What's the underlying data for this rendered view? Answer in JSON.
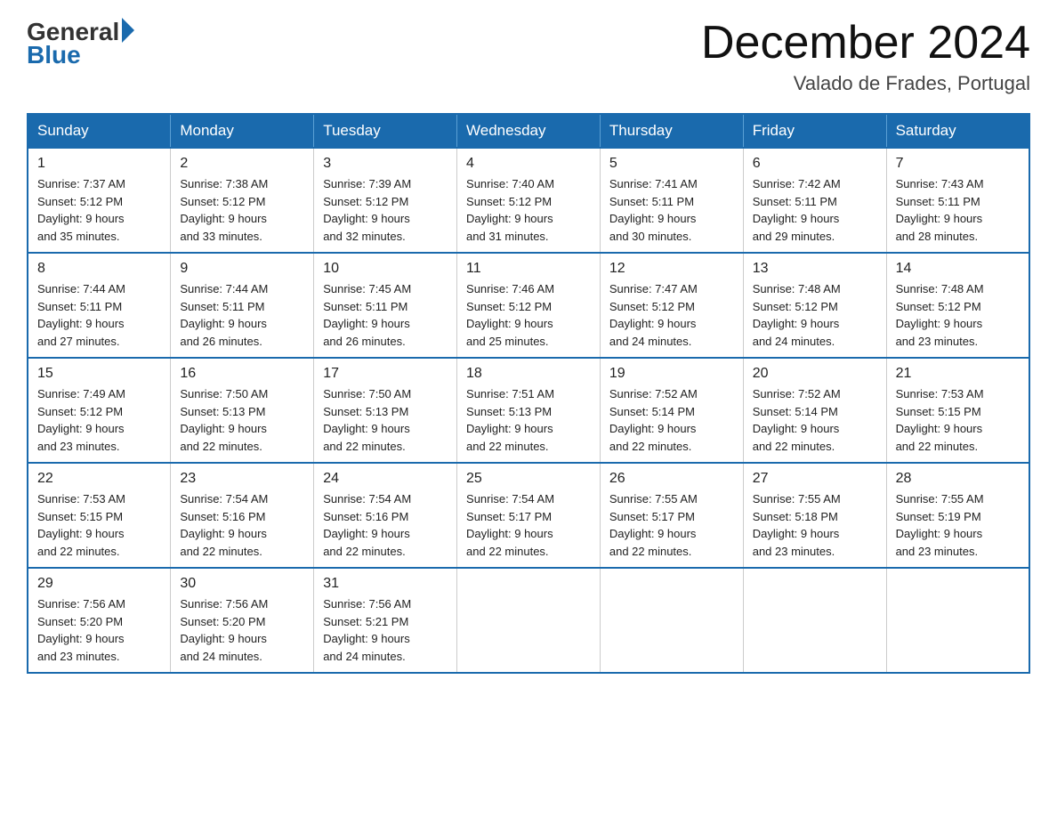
{
  "logo": {
    "general": "General",
    "blue": "Blue"
  },
  "title": "December 2024",
  "location": "Valado de Frades, Portugal",
  "days_of_week": [
    "Sunday",
    "Monday",
    "Tuesday",
    "Wednesday",
    "Thursday",
    "Friday",
    "Saturday"
  ],
  "weeks": [
    [
      {
        "day": "1",
        "sunrise": "7:37 AM",
        "sunset": "5:12 PM",
        "daylight": "9 hours and 35 minutes."
      },
      {
        "day": "2",
        "sunrise": "7:38 AM",
        "sunset": "5:12 PM",
        "daylight": "9 hours and 33 minutes."
      },
      {
        "day": "3",
        "sunrise": "7:39 AM",
        "sunset": "5:12 PM",
        "daylight": "9 hours and 32 minutes."
      },
      {
        "day": "4",
        "sunrise": "7:40 AM",
        "sunset": "5:12 PM",
        "daylight": "9 hours and 31 minutes."
      },
      {
        "day": "5",
        "sunrise": "7:41 AM",
        "sunset": "5:11 PM",
        "daylight": "9 hours and 30 minutes."
      },
      {
        "day": "6",
        "sunrise": "7:42 AM",
        "sunset": "5:11 PM",
        "daylight": "9 hours and 29 minutes."
      },
      {
        "day": "7",
        "sunrise": "7:43 AM",
        "sunset": "5:11 PM",
        "daylight": "9 hours and 28 minutes."
      }
    ],
    [
      {
        "day": "8",
        "sunrise": "7:44 AM",
        "sunset": "5:11 PM",
        "daylight": "9 hours and 27 minutes."
      },
      {
        "day": "9",
        "sunrise": "7:44 AM",
        "sunset": "5:11 PM",
        "daylight": "9 hours and 26 minutes."
      },
      {
        "day": "10",
        "sunrise": "7:45 AM",
        "sunset": "5:11 PM",
        "daylight": "9 hours and 26 minutes."
      },
      {
        "day": "11",
        "sunrise": "7:46 AM",
        "sunset": "5:12 PM",
        "daylight": "9 hours and 25 minutes."
      },
      {
        "day": "12",
        "sunrise": "7:47 AM",
        "sunset": "5:12 PM",
        "daylight": "9 hours and 24 minutes."
      },
      {
        "day": "13",
        "sunrise": "7:48 AM",
        "sunset": "5:12 PM",
        "daylight": "9 hours and 24 minutes."
      },
      {
        "day": "14",
        "sunrise": "7:48 AM",
        "sunset": "5:12 PM",
        "daylight": "9 hours and 23 minutes."
      }
    ],
    [
      {
        "day": "15",
        "sunrise": "7:49 AM",
        "sunset": "5:12 PM",
        "daylight": "9 hours and 23 minutes."
      },
      {
        "day": "16",
        "sunrise": "7:50 AM",
        "sunset": "5:13 PM",
        "daylight": "9 hours and 22 minutes."
      },
      {
        "day": "17",
        "sunrise": "7:50 AM",
        "sunset": "5:13 PM",
        "daylight": "9 hours and 22 minutes."
      },
      {
        "day": "18",
        "sunrise": "7:51 AM",
        "sunset": "5:13 PM",
        "daylight": "9 hours and 22 minutes."
      },
      {
        "day": "19",
        "sunrise": "7:52 AM",
        "sunset": "5:14 PM",
        "daylight": "9 hours and 22 minutes."
      },
      {
        "day": "20",
        "sunrise": "7:52 AM",
        "sunset": "5:14 PM",
        "daylight": "9 hours and 22 minutes."
      },
      {
        "day": "21",
        "sunrise": "7:53 AM",
        "sunset": "5:15 PM",
        "daylight": "9 hours and 22 minutes."
      }
    ],
    [
      {
        "day": "22",
        "sunrise": "7:53 AM",
        "sunset": "5:15 PM",
        "daylight": "9 hours and 22 minutes."
      },
      {
        "day": "23",
        "sunrise": "7:54 AM",
        "sunset": "5:16 PM",
        "daylight": "9 hours and 22 minutes."
      },
      {
        "day": "24",
        "sunrise": "7:54 AM",
        "sunset": "5:16 PM",
        "daylight": "9 hours and 22 minutes."
      },
      {
        "day": "25",
        "sunrise": "7:54 AM",
        "sunset": "5:17 PM",
        "daylight": "9 hours and 22 minutes."
      },
      {
        "day": "26",
        "sunrise": "7:55 AM",
        "sunset": "5:17 PM",
        "daylight": "9 hours and 22 minutes."
      },
      {
        "day": "27",
        "sunrise": "7:55 AM",
        "sunset": "5:18 PM",
        "daylight": "9 hours and 23 minutes."
      },
      {
        "day": "28",
        "sunrise": "7:55 AM",
        "sunset": "5:19 PM",
        "daylight": "9 hours and 23 minutes."
      }
    ],
    [
      {
        "day": "29",
        "sunrise": "7:56 AM",
        "sunset": "5:20 PM",
        "daylight": "9 hours and 23 minutes."
      },
      {
        "day": "30",
        "sunrise": "7:56 AM",
        "sunset": "5:20 PM",
        "daylight": "9 hours and 24 minutes."
      },
      {
        "day": "31",
        "sunrise": "7:56 AM",
        "sunset": "5:21 PM",
        "daylight": "9 hours and 24 minutes."
      },
      null,
      null,
      null,
      null
    ]
  ],
  "labels": {
    "sunrise": "Sunrise:",
    "sunset": "Sunset:",
    "daylight": "Daylight: 9 hours"
  }
}
